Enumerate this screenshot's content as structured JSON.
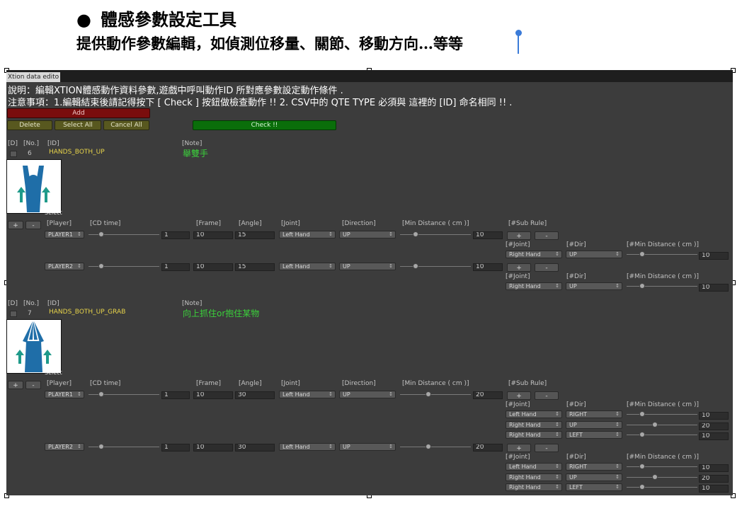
{
  "doc": {
    "bullet": "●",
    "title": "體感參數設定工具",
    "description": "提供動作參數編輯，如偵測位移量、關節、移動方向…等等"
  },
  "window": {
    "tab": "Xtion data edito",
    "info1": "說明：編輯XTION體感動作資料參數,遊戲中呼叫動作ID 所對應參數設定動作條件 .",
    "info2": "注意事項：1.編輯結束後請記得按下 [ Check ] 按鈕做檢查動作 !! 2. CSV中的 QTE TYPE 必須與 這裡的 [ID] 命名相同 !!  .",
    "add_label": "Add",
    "delete_label": "Delete",
    "select_all_label": "Select All",
    "cancel_all_label": "Cancel All",
    "check_label": "Check !!"
  },
  "labels": {
    "d": "[D]",
    "no": "[No.]",
    "id": "[ID]",
    "note": "[Note]",
    "select": "Select",
    "plus": "+",
    "minus": "-",
    "player": "[Player]",
    "cd_time": "[CD time]",
    "frame": "[Frame]",
    "angle": "[Angle]",
    "joint": "[Joint]",
    "direction": "[Direction]",
    "min_distance": "[Min Distance ( cm )]",
    "sub_rule": "[#Sub Rule]",
    "sub_joint": "[#Joint]",
    "sub_dir": "[#Dir]",
    "sub_min_distance": "[#Min Distance ( cm )]"
  },
  "actions": [
    {
      "no": "6",
      "id": "HANDS_BOTH_UP",
      "note": "舉雙手",
      "players": [
        {
          "player": "PLAYER1",
          "cd": "1",
          "frame": "10",
          "angle": "15",
          "joint": "Left Hand",
          "dir": "UP",
          "min": "10",
          "subs": [
            {
              "joint": "Right Hand",
              "dir": "UP",
              "min": "10"
            }
          ]
        },
        {
          "player": "PLAYER2",
          "cd": "1",
          "frame": "10",
          "angle": "15",
          "joint": "Left Hand",
          "dir": "UP",
          "min": "10",
          "subs": [
            {
              "joint": "Right Hand",
              "dir": "UP",
              "min": "10"
            }
          ]
        }
      ]
    },
    {
      "no": "7",
      "id": "HANDS_BOTH_UP_GRAB",
      "note": "向上抓住or抱住某物",
      "players": [
        {
          "player": "PLAYER1",
          "cd": "1",
          "frame": "10",
          "angle": "30",
          "joint": "Left Hand",
          "dir": "UP",
          "min": "20",
          "subs": [
            {
              "joint": "Left Hand",
              "dir": "RIGHT",
              "min": "10"
            },
            {
              "joint": "Right Hand",
              "dir": "UP",
              "min": "20"
            },
            {
              "joint": "Right Hand",
              "dir": "LEFT",
              "min": "10"
            }
          ]
        },
        {
          "player": "PLAYER2",
          "cd": "1",
          "frame": "10",
          "angle": "30",
          "joint": "Left Hand",
          "dir": "UP",
          "min": "20",
          "subs": [
            {
              "joint": "Left Hand",
              "dir": "RIGHT",
              "min": "10"
            },
            {
              "joint": "Right Hand",
              "dir": "UP",
              "min": "20"
            },
            {
              "joint": "Right Hand",
              "dir": "LEFT",
              "min": "10"
            }
          ]
        }
      ]
    }
  ],
  "colors": {
    "window_bg": "#3c3c3c",
    "id_text": "#e8d44a",
    "note_text": "#3bd13b",
    "check_button": "#0a6e0a",
    "add_button": "#7a0d0d",
    "figure": "#1f6ea8",
    "arrow": "#1f9a8a"
  }
}
